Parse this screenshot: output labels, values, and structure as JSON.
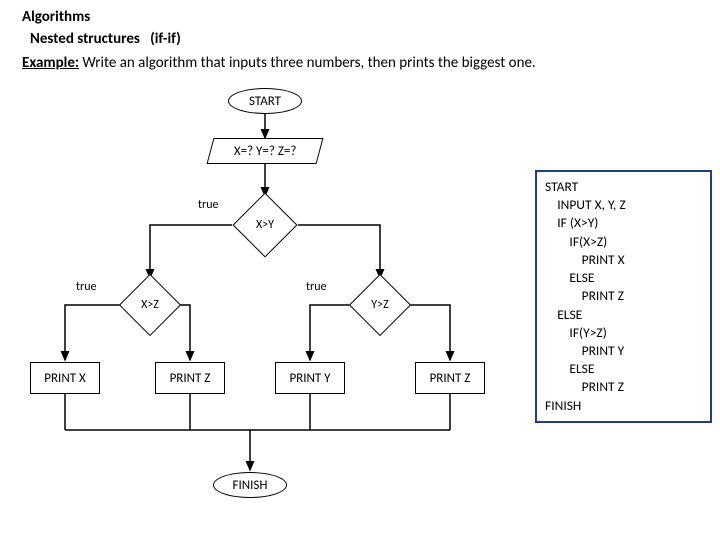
{
  "headings": {
    "title": "Algorithms",
    "subtitle_a": "Nested structures",
    "subtitle_b": "(if-if)",
    "example_prefix": "Example:",
    "example_text": " Write an algorithm that inputs three numbers, then prints the biggest one."
  },
  "flow": {
    "start": "START",
    "input": "X=? Y=? Z=?",
    "cond_xy": "X>Y",
    "cond_xz": "X>Z",
    "cond_yz": "Y>Z",
    "true_label_1": "true",
    "true_label_2": "true",
    "true_label_3": "true",
    "print_x": "PRINT X",
    "print_z_left": "PRINT Z",
    "print_y": "PRINT Y",
    "print_z_right": "PRINT Z",
    "finish": "FINISH"
  },
  "pseudocode": "START\n    INPUT X, Y, Z\n    IF (X>Y)\n        IF(X>Z)\n            PRINT X\n        ELSE\n            PRINT Z\n    ELSE\n        IF(Y>Z)\n            PRINT Y\n        ELSE\n            PRINT Z\nFINISH"
}
